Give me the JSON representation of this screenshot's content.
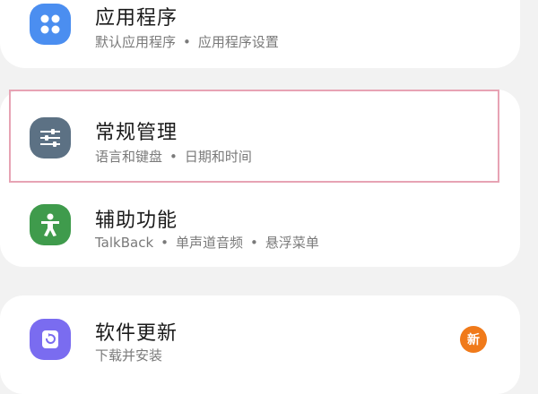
{
  "items": [
    {
      "title": "应用程序",
      "subtitle_parts": [
        "默认应用程序",
        "应用程序设置"
      ],
      "icon": "apps-grid-icon",
      "icon_color": "#4b8ef0"
    },
    {
      "title": "常规管理",
      "subtitle_parts": [
        "语言和键盘",
        "日期和时间"
      ],
      "icon": "sliders-icon",
      "icon_color": "#5c7184"
    },
    {
      "title": "辅助功能",
      "subtitle_parts": [
        "TalkBack",
        "单声道音频",
        "悬浮菜单"
      ],
      "icon": "accessibility-person-icon",
      "icon_color": "#3f9b4c"
    },
    {
      "title": "软件更新",
      "subtitle_parts": [
        "下载并安装"
      ],
      "icon": "software-update-icon",
      "icon_color": "#7a6cf0",
      "badge": "新",
      "badge_color": "#f07a1a"
    }
  ],
  "separator": "•"
}
